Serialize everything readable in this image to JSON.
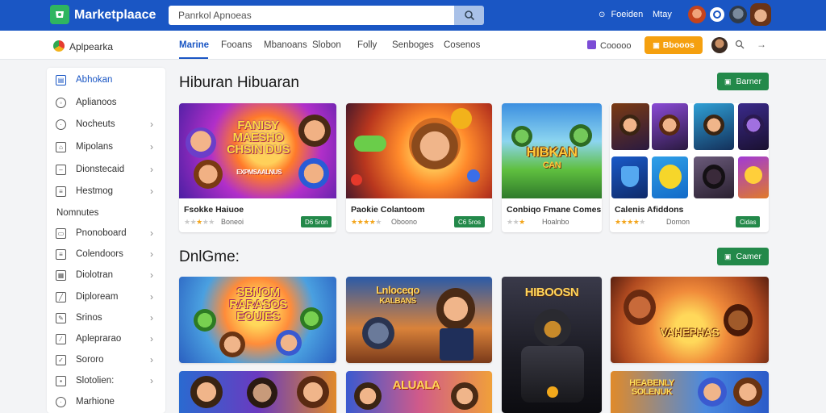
{
  "app": {
    "brand": "Marketplaace"
  },
  "search": {
    "value": "Panrkol Apnoeas"
  },
  "topbar": {
    "link1": "Foeiden",
    "link2": "Mtay"
  },
  "subnav": {
    "app_name": "Aplpearka",
    "tabs": [
      "Marine",
      "Fooans",
      "Mbanoans",
      "Slobon",
      "Folly",
      "Senboges",
      "Cosenos"
    ],
    "link": "Cooooo",
    "orange_button": "Bbooos"
  },
  "sidebar": {
    "items": [
      "Abhokan",
      "Aplianoos",
      "Nocheuts",
      "Mipolans",
      "Dionstecaid",
      "Hestmog"
    ],
    "section": "Nomnutes",
    "items2": [
      "Pnonoboard",
      "Colendoors",
      "Diolotran",
      "Diploream",
      "Srinos",
      "Apleprarao",
      "Sororo",
      "Slotolien:",
      "Marhione"
    ]
  },
  "section1": {
    "title": "Hiburan Hibuaran",
    "button": "Barner",
    "cards": [
      {
        "art": "FANISY MAESHO CHSIN DUS",
        "art_sub": "EXPMSAALNUS",
        "title": "Fsokke Haiuoe",
        "rating_text": "Boneoi",
        "stars": 2,
        "badge": "D6 5ron"
      },
      {
        "art": "",
        "title": "Paokie Colantoom",
        "rating_text": "Oboono",
        "stars": 4,
        "badge": "C6 5ros"
      },
      {
        "art": "HIBKAN",
        "art_sub": "CAN",
        "title": "Conbiqo Fmane Comes",
        "rating_text": "Hoalnbo",
        "stars": 3,
        "badge": ""
      },
      {
        "art": "",
        "title": "Calenis Afiddons",
        "rating_text": "Domon",
        "stars": 4,
        "badge": "Cidas"
      }
    ]
  },
  "section2": {
    "title": "DnlGme:",
    "button": "Camer",
    "cards": [
      {
        "art": "SBNOM RARASOS EOUIES"
      },
      {
        "art": "Lnloceqo",
        "art_sub": "KALBANS"
      },
      {
        "art": "HIBOOSN"
      },
      {
        "art": "VAHEPHAS"
      }
    ],
    "row2_art": [
      "ALUALA",
      "HEABENLY SOLENUK"
    ]
  },
  "colors": {
    "topbar": "#1a56c4",
    "accent_green": "#23894a",
    "accent_orange": "#f5a00f"
  }
}
